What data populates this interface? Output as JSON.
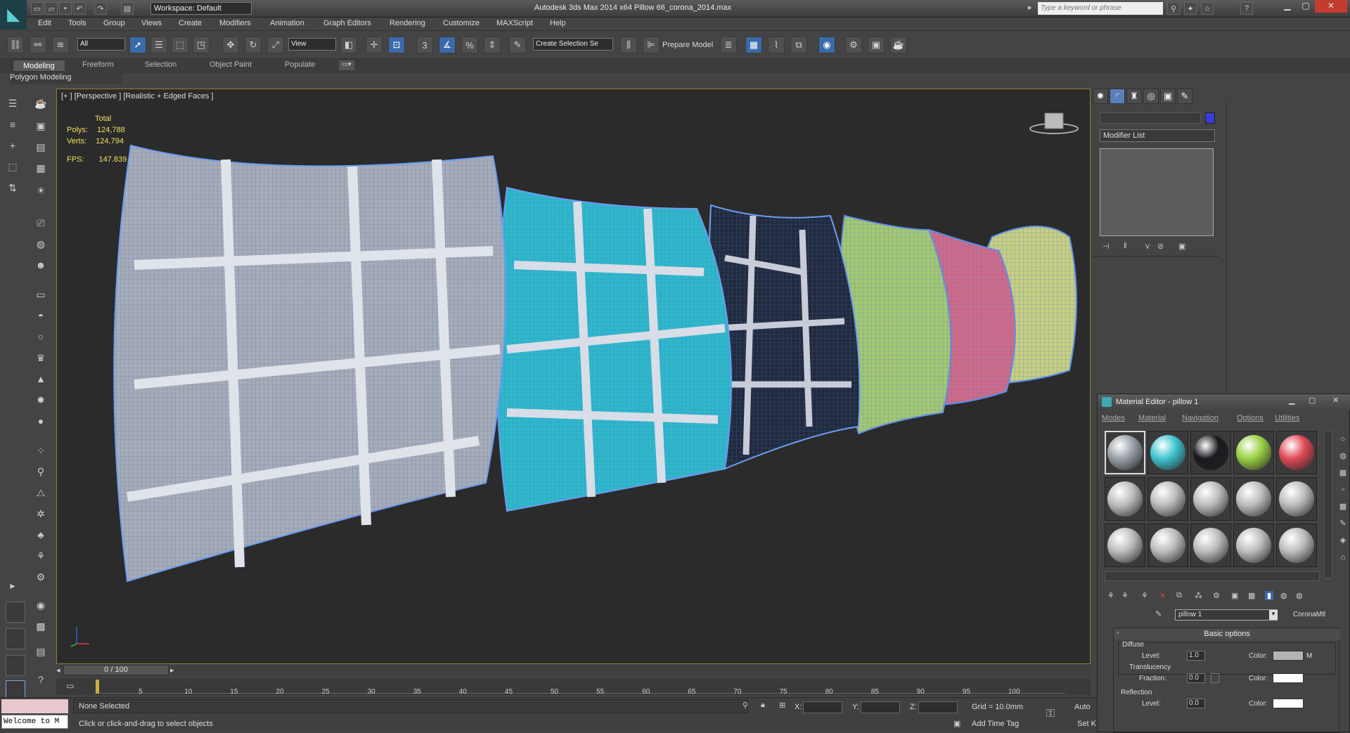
{
  "titlebar": {
    "workspace": "Workspace: Default",
    "title": "Autodesk 3ds Max  2014 x64      Pillow 66_corona_2014.max",
    "search_placeholder": "Type a keyword or phrase"
  },
  "menu": [
    "Edit",
    "Tools",
    "Group",
    "Views",
    "Create",
    "Modifiers",
    "Animation",
    "Graph Editors",
    "Rendering",
    "Customize",
    "MAXScript",
    "Help"
  ],
  "toolbar": {
    "selection_filter": "All",
    "ref_coord": "View",
    "named_selection": "Create Selection Se",
    "prepare_model": "Prepare Model"
  },
  "ribbon": {
    "tabs": [
      "Modeling",
      "Freeform",
      "Selection",
      "Object Paint",
      "Populate"
    ],
    "panel": "Polygon Modeling"
  },
  "viewport": {
    "label": "[+ ] [Perspective ] [Realistic + Edged Faces ]",
    "stats_header": "Total",
    "polys_label": "Polys:",
    "polys": "124,788",
    "verts_label": "Verts:",
    "verts": "124,794",
    "fps_label": "FPS:",
    "fps": "147.839"
  },
  "timeline": {
    "frame": "0 / 100",
    "ticks": [
      "5",
      "10",
      "15",
      "20",
      "25",
      "30",
      "35",
      "40",
      "45",
      "50",
      "55",
      "60",
      "65",
      "70",
      "75",
      "80",
      "85",
      "90",
      "95",
      "100"
    ]
  },
  "status": {
    "welcome": "Welcome to M",
    "selection": "None Selected",
    "prompt": "Click or click-and-drag to select objects",
    "x_label": "X:",
    "y_label": "Y:",
    "z_label": "Z:",
    "grid": "Grid = 10.0mm",
    "add_time_tag": "Add Time Tag",
    "auto_key": "Auto",
    "set_key": "Set K"
  },
  "command_panel": {
    "modifier_list": "Modifier List"
  },
  "material_editor": {
    "title": "Material Editor - pillow 1",
    "menu": [
      "Modes",
      "Material",
      "Navigation",
      "Options",
      "Utilities"
    ],
    "material_name": "pillow 1",
    "material_type": "CoronaMtl",
    "rollout": "Basic options",
    "diffuse": "Diffuse",
    "level_label": "Level:",
    "diffuse_level": "1.0",
    "color_label": "Color:",
    "map_flag": "M",
    "translucency": "Translucency",
    "fraction_label": "Fraction:",
    "fraction": "0.0",
    "reflection": "Reflection",
    "refl_level": "0.0",
    "slot_colors": [
      "#9aa0a8",
      "#3fc4cf",
      "#1b1b1f",
      "#9bd046",
      "#e04a58"
    ],
    "slot_default": "#bdbdbd"
  }
}
